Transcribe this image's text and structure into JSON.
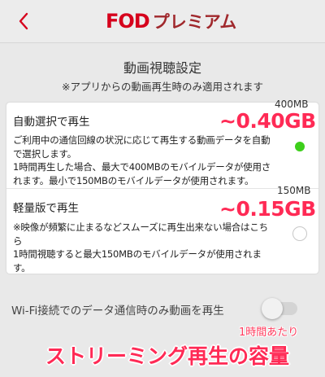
{
  "colors": {
    "brand": "#d6001c",
    "premium": "#a0282c",
    "accent_green": "#3dcf1b",
    "overlay_pink": "#ff2a55"
  },
  "header": {
    "back_icon": "chevron-left-icon",
    "logo_fod": "FOD",
    "logo_premium": "プレミアム"
  },
  "page": {
    "title": "動画視聴設定",
    "subtitle": "※アプリからの動画再生時のみ適用されます"
  },
  "options": [
    {
      "title": "自動選択で再生",
      "size": "400MB",
      "overlay": "~0.40GB",
      "desc_lines": [
        "ご利用中の通信回線の状況に応じて再生する動画データを自動",
        "で選択します。",
        "1時間再生した場合、最大で400MBのモバイルデータが使用さ",
        "れます。最小で150MBのモバイルデータが使用されます。"
      ],
      "selected": true
    },
    {
      "title": "軽量版で再生",
      "size": "150MB",
      "overlay": "~0.15GB",
      "desc_lines": [
        "※映像が頻繁に止まるなどスムーズに再生出来ない場合はこち",
        "ら",
        "1時間視聴すると最大150MBのモバイルデータが使用されま",
        "す。"
      ],
      "selected": false
    }
  ],
  "wifi": {
    "label": "Wi-Fi接続でのデータ通信時のみ動画を再生",
    "enabled": false
  },
  "caption": {
    "small": "1時間あたり",
    "big": "ストリーミング再生の容量"
  }
}
